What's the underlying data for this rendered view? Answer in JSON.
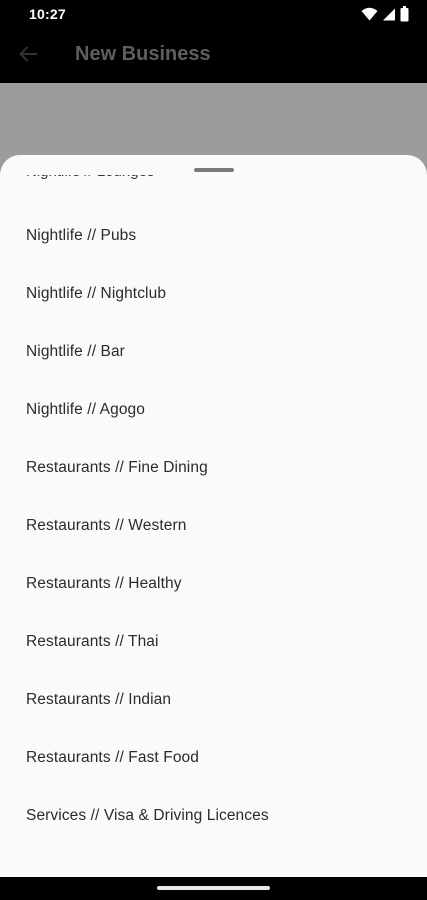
{
  "status_bar": {
    "time": "10:27",
    "icons": [
      "wifi-icon",
      "signal-icon",
      "battery-icon"
    ]
  },
  "app_bar": {
    "title": "New Business",
    "back_icon": "arrow-back-icon"
  },
  "sheet": {
    "peek_text": "Nightlife // Lounges",
    "options": [
      "Nightlife // Pubs",
      "Nightlife // Nightclub",
      "Nightlife // Bar",
      "Nightlife // Agogo",
      "Restaurants // Fine Dining",
      "Restaurants // Western",
      "Restaurants // Healthy",
      "Restaurants // Thai",
      "Restaurants // Indian",
      "Restaurants // Fast Food",
      "Services // Visa & Driving Licences"
    ]
  },
  "colors": {
    "app_bar_bg": "#000000",
    "scrim": "#9c9c9c",
    "sheet_bg": "#fafafa",
    "option_text": "#2b2b2b",
    "title_text": "#5e5e5e"
  }
}
